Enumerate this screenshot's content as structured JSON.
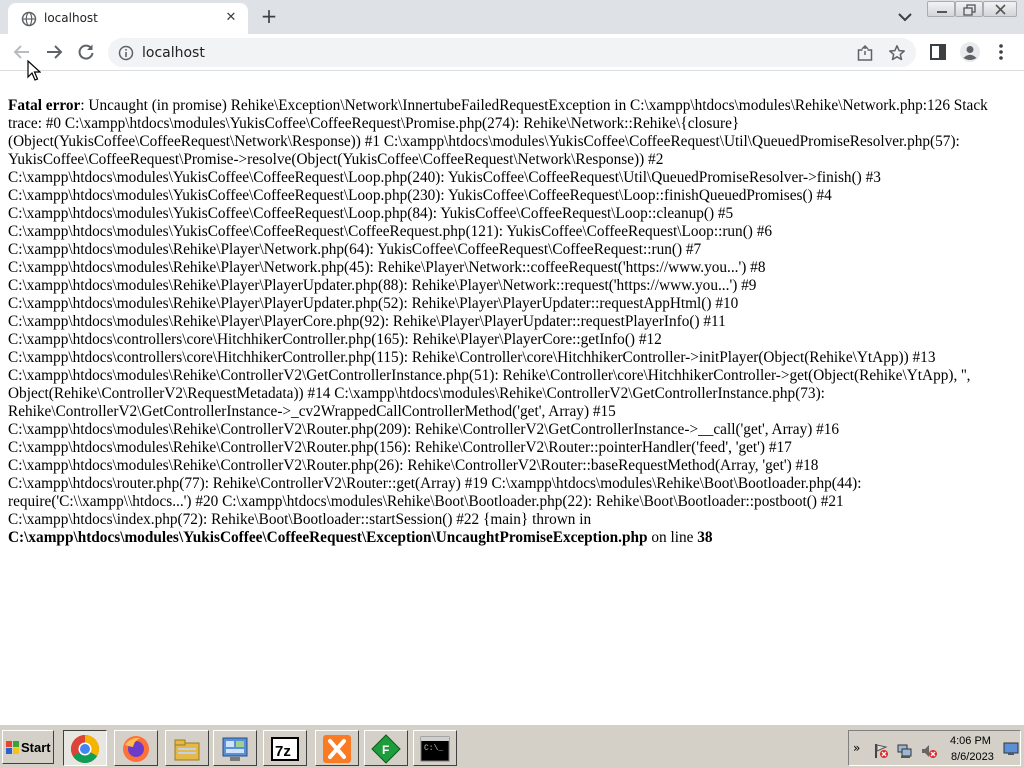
{
  "browser": {
    "tab_title": "localhost",
    "tab_close": "✕",
    "new_tab": "+",
    "url": "localhost"
  },
  "page": {
    "error_label": "Fatal error",
    "error_text": ": Uncaught (in promise) Rehike\\Exception\\Network\\InnertubeFailedRequestException in C:\\xampp\\htdocs\\modules\\Rehike\\Network.php:126 Stack trace: #0 C:\\xampp\\htdocs\\modules\\YukisCoffee\\CoffeeRequest\\Promise.php(274): Rehike\\Network::Rehike\\{closure}(Object(YukisCoffee\\CoffeeRequest\\Network\\Response)) #1 C:\\xampp\\htdocs\\modules\\YukisCoffee\\CoffeeRequest\\Util\\QueuedPromiseResolver.php(57): YukisCoffee\\CoffeeRequest\\Promise->resolve(Object(YukisCoffee\\CoffeeRequest\\Network\\Response)) #2 C:\\xampp\\htdocs\\modules\\YukisCoffee\\CoffeeRequest\\Loop.php(240): YukisCoffee\\CoffeeRequest\\Util\\QueuedPromiseResolver->finish() #3 C:\\xampp\\htdocs\\modules\\YukisCoffee\\CoffeeRequest\\Loop.php(230): YukisCoffee\\CoffeeRequest\\Loop::finishQueuedPromises() #4 C:\\xampp\\htdocs\\modules\\YukisCoffee\\CoffeeRequest\\Loop.php(84): YukisCoffee\\CoffeeRequest\\Loop::cleanup() #5 C:\\xampp\\htdocs\\modules\\YukisCoffee\\CoffeeRequest\\CoffeeRequest.php(121): YukisCoffee\\CoffeeRequest\\Loop::run() #6 C:\\xampp\\htdocs\\modules\\Rehike\\Player\\Network.php(64): YukisCoffee\\CoffeeRequest\\CoffeeRequest::run() #7 C:\\xampp\\htdocs\\modules\\Rehike\\Player\\Network.php(45): Rehike\\Player\\Network::coffeeRequest('https://www.you...') #8 C:\\xampp\\htdocs\\modules\\Rehike\\Player\\PlayerUpdater.php(88): Rehike\\Player\\Network::request('https://www.you...') #9 C:\\xampp\\htdocs\\modules\\Rehike\\Player\\PlayerUpdater.php(52): Rehike\\Player\\PlayerUpdater::requestAppHtml() #10 C:\\xampp\\htdocs\\modules\\Rehike\\Player\\PlayerCore.php(92): Rehike\\Player\\PlayerUpdater::requestPlayerInfo() #11 C:\\xampp\\htdocs\\controllers\\core\\HitchhikerController.php(165): Rehike\\Player\\PlayerCore::getInfo() #12 C:\\xampp\\htdocs\\controllers\\core\\HitchhikerController.php(115): Rehike\\Controller\\core\\HitchhikerController->initPlayer(Object(Rehike\\YtApp)) #13 C:\\xampp\\htdocs\\modules\\Rehike\\ControllerV2\\GetControllerInstance.php(51): Rehike\\Controller\\core\\HitchhikerController->get(Object(Rehike\\YtApp), '', Object(Rehike\\ControllerV2\\RequestMetadata)) #14 C:\\xampp\\htdocs\\modules\\Rehike\\ControllerV2\\GetControllerInstance.php(73): Rehike\\ControllerV2\\GetControllerInstance->_cv2WrappedCallControllerMethod('get', Array) #15 C:\\xampp\\htdocs\\modules\\Rehike\\ControllerV2\\Router.php(209): Rehike\\ControllerV2\\GetControllerInstance->__call('get', Array) #16 C:\\xampp\\htdocs\\modules\\Rehike\\ControllerV2\\Router.php(156): Rehike\\ControllerV2\\Router::pointerHandler('feed', 'get') #17 C:\\xampp\\htdocs\\modules\\Rehike\\ControllerV2\\Router.php(26): Rehike\\ControllerV2\\Router::baseRequestMethod(Array, 'get') #18 C:\\xampp\\htdocs\\router.php(77): Rehike\\ControllerV2\\Router::get(Array) #19 C:\\xampp\\htdocs\\modules\\Rehike\\Boot\\Bootloader.php(44): require('C:\\\\xampp\\\\htdocs...') #20 C:\\xampp\\htdocs\\modules\\Rehike\\Boot\\Bootloader.php(22): Rehike\\Boot\\Bootloader::postboot() #21 C:\\xampp\\htdocs\\index.php(72): Rehike\\Boot\\Bootloader::startSession() #22 {main} thrown in",
    "error_file": "C:\\xampp\\htdocs\\modules\\YukisCoffee\\CoffeeRequest\\Exception\\UncaughtPromiseException.php",
    "on_line_text": " on line ",
    "line_number": "38"
  },
  "taskbar": {
    "start_label": "Start",
    "apps": [
      "chrome-icon",
      "firefox-icon",
      "file-explorer-icon",
      "control-panel-icon",
      "7zip-icon",
      "xampp-icon",
      "filezilla-icon",
      "command-prompt-icon"
    ],
    "tray_arrow": "»",
    "time": "4:06 PM",
    "date": "8/6/2023"
  },
  "colors": {
    "tab_strip": "#dee1e6",
    "omnibox": "#f1f3f4",
    "taskbar": "#d4d0c8"
  }
}
